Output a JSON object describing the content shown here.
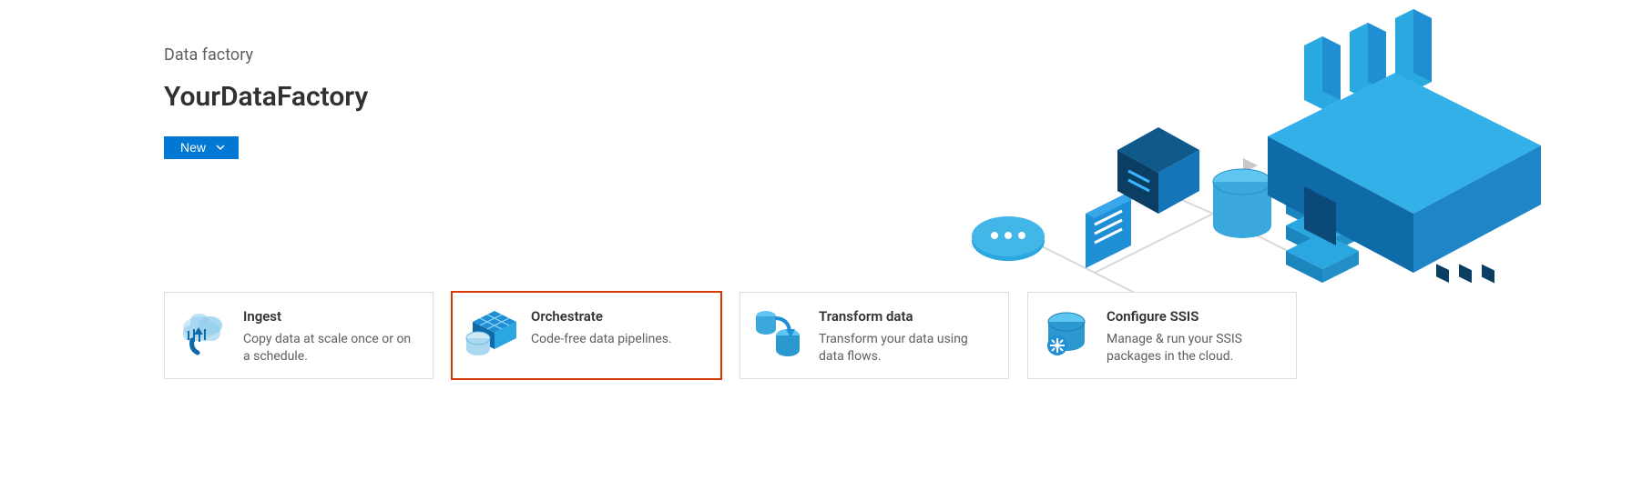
{
  "header": {
    "breadcrumb": "Data factory",
    "title": "YourDataFactory",
    "new_button_label": "New"
  },
  "cards": [
    {
      "title": "Ingest",
      "desc": "Copy data at scale once or on a schedule."
    },
    {
      "title": "Orchestrate",
      "desc": "Code-free data pipelines."
    },
    {
      "title": "Transform data",
      "desc": "Transform your data using data flows."
    },
    {
      "title": "Configure SSIS",
      "desc": "Manage & run your SSIS packages in the cloud."
    }
  ]
}
